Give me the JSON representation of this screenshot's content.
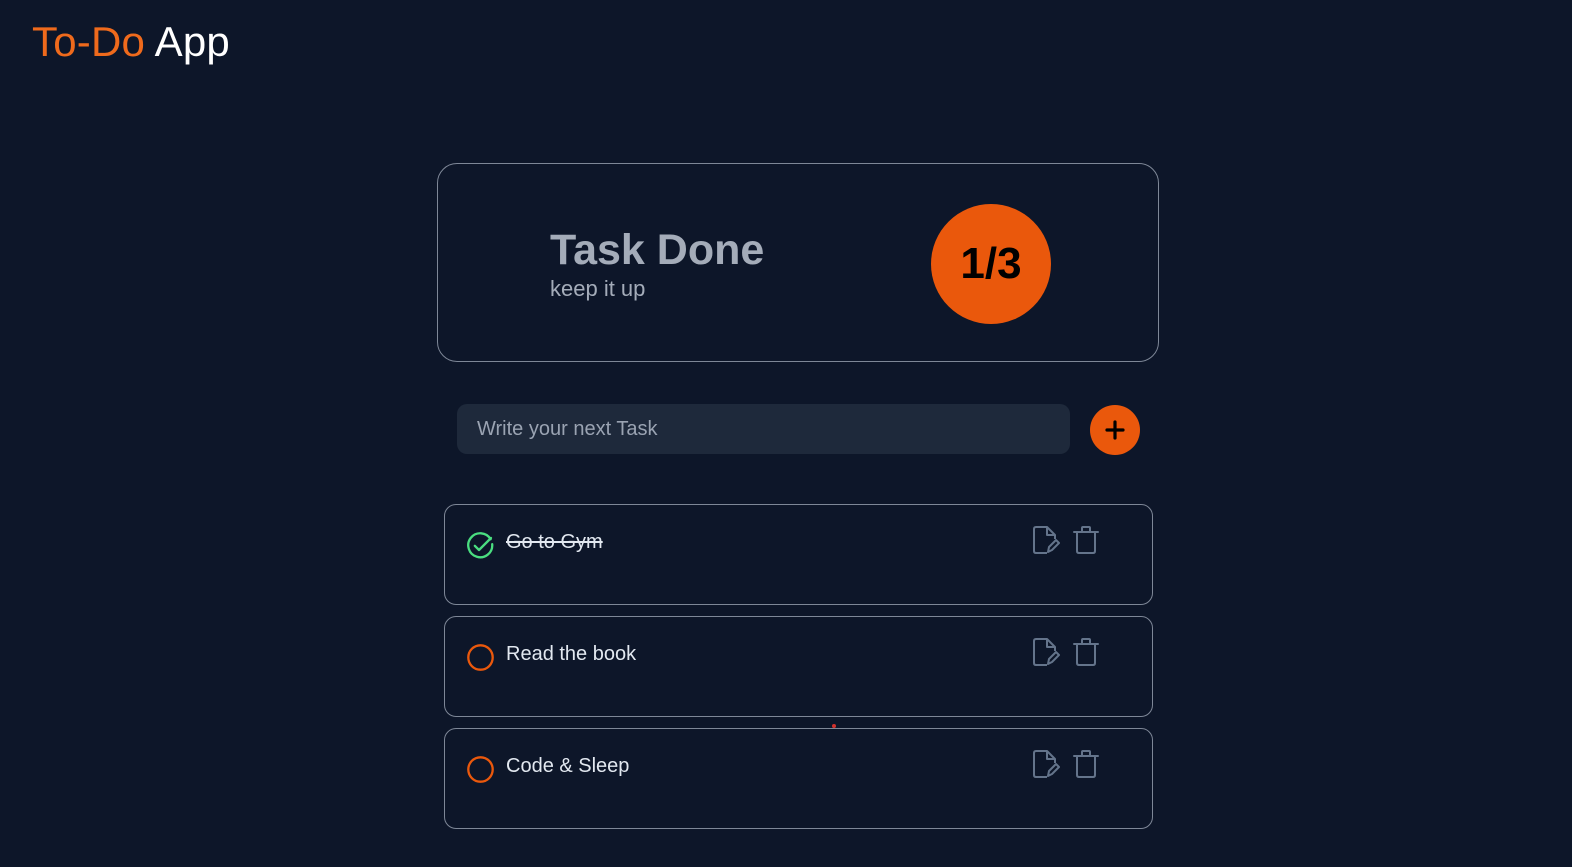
{
  "header": {
    "title_accent": "To-Do",
    "title_rest": "App"
  },
  "summary": {
    "heading": "Task Done",
    "subtext": "keep it up",
    "progress_label": "1/3",
    "completed": 1,
    "total": 3
  },
  "new_task": {
    "placeholder": "Write your next Task",
    "value": "",
    "add_icon": "plus-icon"
  },
  "tasks": [
    {
      "label": "Go to Gym",
      "done": true,
      "status_icon": "check-circle-icon"
    },
    {
      "label": "Read the book",
      "done": false,
      "status_icon": "empty-circle-icon"
    },
    {
      "label": "Code & Sleep",
      "done": false,
      "status_icon": "empty-circle-icon"
    }
  ],
  "task_actions": {
    "edit_icon": "edit-icon",
    "delete_icon": "trash-icon"
  },
  "colors": {
    "background": "#0d1629",
    "accent": "#ea580c",
    "done_green": "#4ade80",
    "card_border": "#7e8797",
    "muted_icon": "#64748b",
    "input_bg": "#1e293b"
  }
}
